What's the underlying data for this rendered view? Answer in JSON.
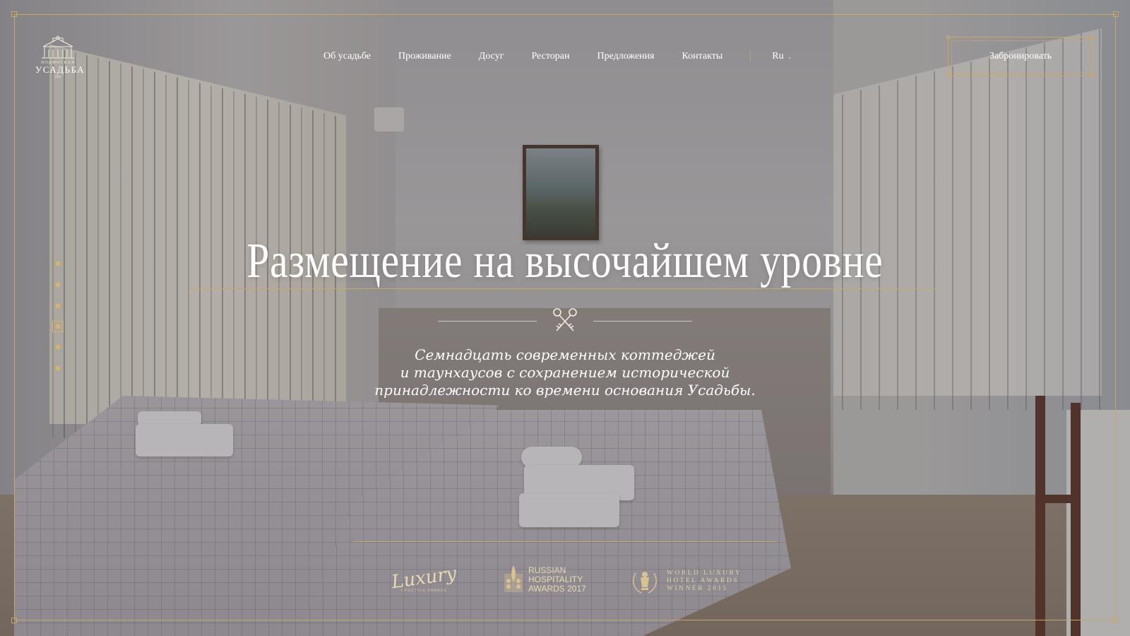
{
  "brand": {
    "name_top": "ПОДМОСКАЯ",
    "name_main": "УСАДЬБА",
    "year": "1842"
  },
  "nav": {
    "items": [
      {
        "label": "Об усадьбе"
      },
      {
        "label": "Проживание"
      },
      {
        "label": "Досуг"
      },
      {
        "label": "Ресторан"
      },
      {
        "label": "Предложения"
      },
      {
        "label": "Контакты"
      }
    ],
    "language": "Ru"
  },
  "header": {
    "book_label": "Забронировать"
  },
  "slider": {
    "total": 6,
    "active_index": 4
  },
  "hero": {
    "title": "Размещение на высочайшем уровне",
    "subtitle_line1": "Семнадцать современных коттеджей",
    "subtitle_line2": "и таунхаусов с сохранением исторической",
    "subtitle_line3": "принадлежности ко времени основания Усадьбы."
  },
  "awards": [
    {
      "name": "Luxury",
      "sub": "LIFESTYLE AWARDS"
    },
    {
      "line1": "RUSSIAN",
      "line2": "HOSPITALITY",
      "line3": "AWARDS 2017"
    },
    {
      "line1": "WORLD LUXURY",
      "line2": "HOTEL AWARDS",
      "line3": "WINNER 2015"
    }
  ],
  "colors": {
    "gold": "#c7a86a",
    "overlay": "#3c373e"
  },
  "icons": {
    "logo": "manor-house-logo",
    "divider": "crossed-keys-icon",
    "lang_dropdown": "chevron-down-icon"
  }
}
